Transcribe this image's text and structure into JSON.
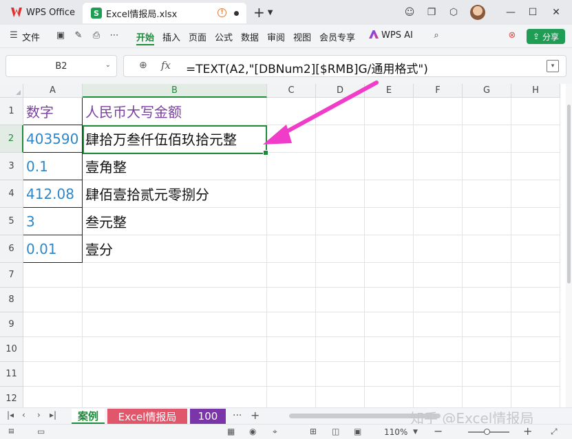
{
  "titlebar": {
    "app_name": "WPS Office",
    "doc_tab_label": "Excel情报局.xlsx",
    "xls_badge": "S",
    "new_tab": "+",
    "icons": [
      "plus-icon",
      "chevron-down-icon",
      "theme-icon",
      "window-icon",
      "cube-icon",
      "avatar",
      "minimize-icon",
      "maximize-icon",
      "close-icon"
    ]
  },
  "ribbon": {
    "file_label": "文件",
    "tabs": [
      "开始",
      "插入",
      "页面",
      "公式",
      "数据",
      "审阅",
      "视图",
      "会员专享"
    ],
    "active_tab": "开始",
    "wps_ai_label": "WPS AI",
    "share_label": "分享",
    "colors": {
      "accent": "#1e8b3a",
      "share_bg": "#1f9d55"
    }
  },
  "formula_bar": {
    "name_box": "B2",
    "fx_label": "fx",
    "formula": "=TEXT(A2,\"[DBNum2][$RMB]G/通用格式\")"
  },
  "grid": {
    "columns": [
      "A",
      "B",
      "C",
      "D",
      "E",
      "F",
      "G",
      "H"
    ],
    "rows": [
      "1",
      "2",
      "3",
      "4",
      "5",
      "6",
      "7",
      "8",
      "9",
      "10",
      "11",
      "12"
    ],
    "selected_cell": "B2",
    "cells": {
      "A1": "数字",
      "B1": "人民币大写金额",
      "A2": "403590",
      "B2": "肆拾万叁仟伍佰玖拾元整",
      "A3": "0.1",
      "B3": "壹角整",
      "A4": "412.08",
      "B4": "肆佰壹拾贰元零捌分",
      "A5": "3",
      "B5": "叁元整",
      "A6": "0.01",
      "B6": "壹分"
    },
    "colors": {
      "number": "#2f86c7",
      "header": "#7a3fa0",
      "arrow": "#f03cc8"
    }
  },
  "sheets": {
    "tabs": [
      "案例",
      "Excel情报局",
      "100"
    ],
    "active": "案例",
    "more": "···",
    "add": "+",
    "watermark": "知乎 @Excel情报局"
  },
  "status": {
    "zoom": "110%",
    "zoom_minus": "−",
    "zoom_plus": "+"
  }
}
